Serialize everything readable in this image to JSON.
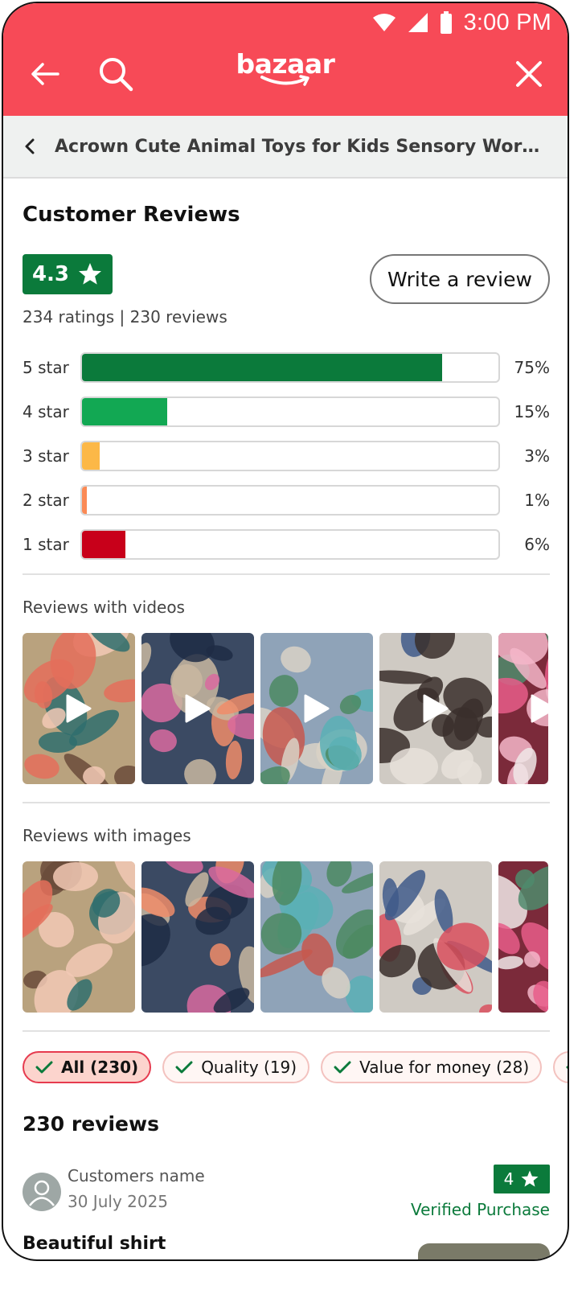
{
  "status_bar": {
    "time": "3:00 PM"
  },
  "app_bar": {
    "logo_text": "bazaar"
  },
  "breadcrumb": {
    "title": "Acrown Cute Animal Toys for Kids Sensory Worm Animal Toys"
  },
  "reviews_summary": {
    "heading": "Customer Reviews",
    "rating": "4.3",
    "counts_text": "234 ratings | 230 reviews",
    "write_review_label": "Write a review",
    "distribution": [
      {
        "label": "5 star",
        "percent_text": "75%",
        "fraction": 0.865,
        "color": "#0b7a3b"
      },
      {
        "label": "4 star",
        "percent_text": "15%",
        "fraction": 0.205,
        "color": "#12a853"
      },
      {
        "label": "3 star",
        "percent_text": "3%",
        "fraction": 0.043,
        "color": "#fcb847"
      },
      {
        "label": "2 star",
        "percent_text": "1%",
        "fraction": 0.012,
        "color": "#fb8a55"
      },
      {
        "label": "1 star",
        "percent_text": "6%",
        "fraction": 0.104,
        "color": "#c8001a"
      }
    ]
  },
  "videos_section": {
    "heading": "Reviews with videos"
  },
  "images_section": {
    "heading": "Reviews with images"
  },
  "filters": [
    {
      "label": "All (230)",
      "active": true
    },
    {
      "label": "Quality (19)",
      "active": false
    },
    {
      "label": "Value for money (28)",
      "active": false
    },
    {
      "label": "",
      "active": false
    }
  ],
  "reviews_list": {
    "heading": "230 reviews",
    "items": [
      {
        "name": "Customers name",
        "date": "30 July 2025",
        "rating": "4",
        "verified_label": "Verified Purchase",
        "title": "Beautiful shirt"
      }
    ]
  },
  "colors": {
    "brand": "#f74a57",
    "rating_green": "#0b7a3b",
    "chip_active_border": "#e63b4f"
  }
}
